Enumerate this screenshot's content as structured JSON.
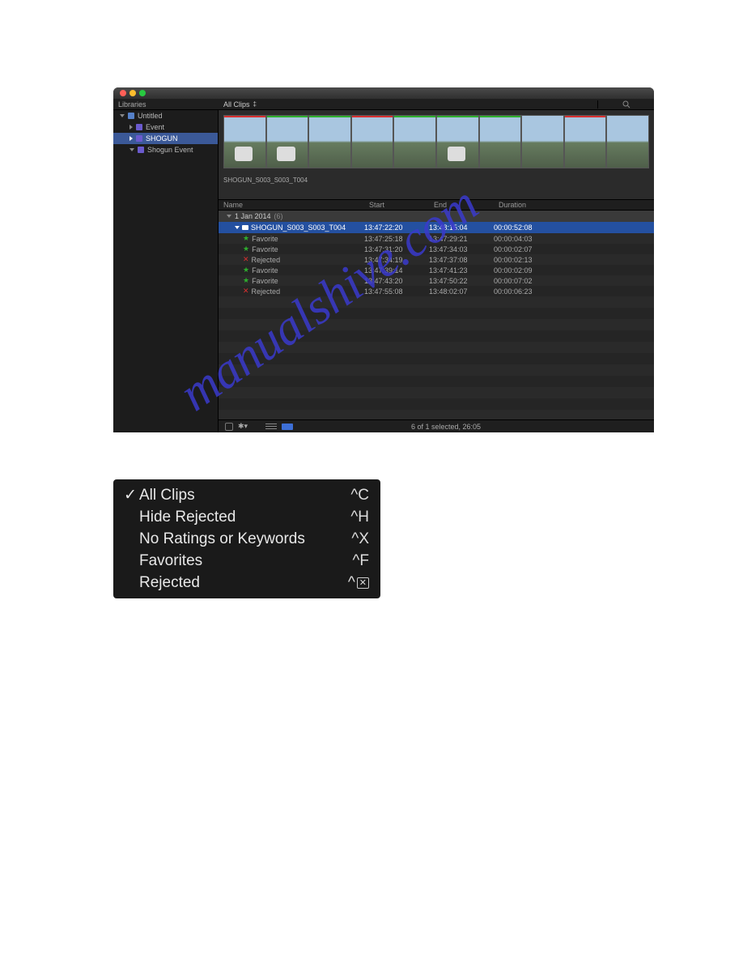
{
  "watermark": "manualshive.com",
  "toolbar": {
    "libraries_label": "Libraries",
    "filter_label": "All Clips"
  },
  "sidebar": {
    "library": "Untitled",
    "items": [
      {
        "label": "Event"
      },
      {
        "label": "SHOGUN"
      },
      {
        "label": "Shogun Event"
      }
    ]
  },
  "clip_name": "SHOGUN_S003_S003_T004",
  "columns": {
    "name": "Name",
    "start": "Start",
    "end": "End",
    "duration": "Duration"
  },
  "group_date": "1 Jan 2014",
  "group_count": "(6)",
  "rows": [
    {
      "type": "clip",
      "name": "SHOGUN_S003_S003_T004",
      "start": "13:47:22:20",
      "end": "13:48:15:04",
      "dur": "00:00:52:08"
    },
    {
      "type": "favorite",
      "name": "Favorite",
      "start": "13:47:25:18",
      "end": "13:47:29:21",
      "dur": "00:00:04:03"
    },
    {
      "type": "favorite",
      "name": "Favorite",
      "start": "13:47:31:20",
      "end": "13:47:34:03",
      "dur": "00:00:02:07"
    },
    {
      "type": "rejected",
      "name": "Rejected",
      "start": "13:47:34:19",
      "end": "13:47:37:08",
      "dur": "00:00:02:13"
    },
    {
      "type": "favorite",
      "name": "Favorite",
      "start": "13:47:39:14",
      "end": "13:47:41:23",
      "dur": "00:00:02:09"
    },
    {
      "type": "favorite",
      "name": "Favorite",
      "start": "13:47:43:20",
      "end": "13:47:50:22",
      "dur": "00:00:07:02"
    },
    {
      "type": "rejected",
      "name": "Rejected",
      "start": "13:47:55:08",
      "end": "13:48:02:07",
      "dur": "00:00:06:23"
    }
  ],
  "status_text": "6 of 1 selected, 26:05",
  "menu": {
    "items": [
      {
        "label": "All Clips",
        "shortcut": "^C",
        "checked": true
      },
      {
        "label": "Hide Rejected",
        "shortcut": "^H",
        "checked": false
      },
      {
        "label": "No Ratings or Keywords",
        "shortcut": "^X",
        "checked": false
      },
      {
        "label": "Favorites",
        "shortcut": "^F",
        "checked": false
      },
      {
        "label": "Rejected",
        "shortcut": "^⌫",
        "checked": false
      }
    ]
  }
}
